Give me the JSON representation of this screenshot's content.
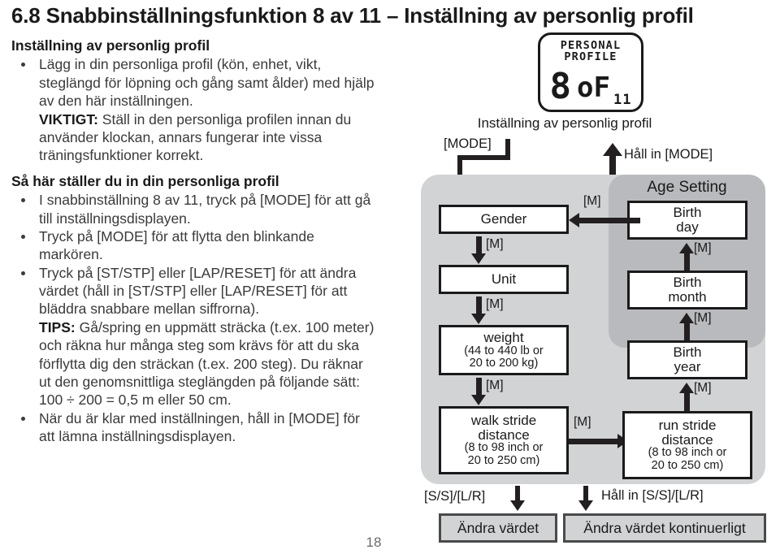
{
  "page": {
    "title": "6.8 Snabbinställningsfunktion 8 av 11 – Inställning av personlig profil",
    "number": "18"
  },
  "left": {
    "heading1": "Inställning av personlig profil",
    "bullet1_line1": "Lägg in din personliga profil (kön, enhet, vikt, steglängd för löpning och gång samt ålder) med hjälp av den här inställningen.",
    "bullet1_important_label": "VIKTIGT:",
    "bullet1_important_text": " Ställ in den personliga profilen innan du använder klockan, annars fungerar inte vissa träningsfunktioner korrekt.",
    "heading2": "Så här ställer du in din personliga profil",
    "bullet2": "I snabbinställning 8 av 11, tryck på [MODE] för att gå till inställningsdisplayen.",
    "bullet3": "Tryck på [MODE] för att flytta den blinkande markören.",
    "bullet4": "Tryck på [ST/STP] eller [LAP/RESET] för att ändra värdet (håll in [ST/STP] eller [LAP/RESET] för att bläddra snabbare mellan siffrorna).",
    "bullet4_tips_label": "TIPS:",
    "bullet4_tips_text": " Gå/spring en uppmätt sträcka (t.ex. 100 meter) och räkna hur många steg som krävs för att du ska förflytta dig den sträckan (t.ex. 200 steg). Du räknar ut den genomsnittliga steglängden på följande sätt: 100 ÷ 200 = 0,5 m eller 50 cm.",
    "bullet5": "När du är klar med inställningen, håll in [MODE] för att lämna inställningsdisplayen."
  },
  "diagram": {
    "lcd": {
      "line1": "PERSONAL",
      "line2": "PROFILE",
      "big_number": "8",
      "big_of": "oF",
      "big_total": "11"
    },
    "caption": "Inställning av personlig profil",
    "mode_label": "[MODE]",
    "hold_mode_label": "Håll in [MODE]",
    "age_setting_title": "Age Setting",
    "m_label": "[M]",
    "boxes": {
      "gender": "Gender",
      "unit": "Unit",
      "weight_title": "weight",
      "weight_sub1": "(44 to 440 lb or",
      "weight_sub2": "20 to 200 kg)",
      "walk_title1": "walk stride",
      "walk_title2": "distance",
      "walk_sub1": "(8 to 98 inch or",
      "walk_sub2": "20 to 250 cm)",
      "birth_day1": "Birth",
      "birth_day2": "day",
      "birth_month1": "Birth",
      "birth_month2": "month",
      "birth_year1": "Birth",
      "birth_year2": "year",
      "run_title1": "run stride",
      "run_title2": "distance",
      "run_sub1": "(8 to 98 inch or",
      "run_sub2": "20 to 250 cm)"
    },
    "legend": {
      "ss_lr_label": "[S/S]/[L/R]",
      "hold_ss_lr_label": "Håll in [S/S]/[L/R]",
      "change_value": "Ändra värdet",
      "change_value_cont": "Ändra värdet kontinuerligt"
    }
  },
  "colors": {
    "ink": "#231f20",
    "panel_outer": "#d2d3d5",
    "panel_age": "#b9babd",
    "body_text": "#3a3a3a"
  }
}
